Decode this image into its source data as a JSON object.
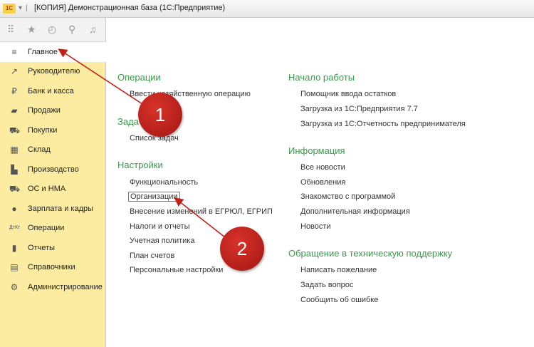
{
  "window": {
    "logo_text": "1С",
    "title": "[КОПИЯ] Демонстрационная база  (1С:Предприятие)"
  },
  "toolbar_icons": [
    "apps-grid-icon",
    "star-icon",
    "history-icon",
    "search-icon",
    "bell-icon"
  ],
  "sidebar": {
    "items": [
      {
        "label": "Главное",
        "icon": "menu-lines-icon",
        "glyph": "≡"
      },
      {
        "label": "Руководителю",
        "icon": "trend-icon",
        "glyph": "↗"
      },
      {
        "label": "Банк и касса",
        "icon": "coin-icon",
        "glyph": "₽"
      },
      {
        "label": "Продажи",
        "icon": "bag-icon",
        "glyph": "▰"
      },
      {
        "label": "Покупки",
        "icon": "cart-icon",
        "glyph": "⛟"
      },
      {
        "label": "Склад",
        "icon": "warehouse-icon",
        "glyph": "▦"
      },
      {
        "label": "Производство",
        "icon": "factory-icon",
        "glyph": "▙"
      },
      {
        "label": "ОС и НМА",
        "icon": "truck-icon",
        "glyph": "⛟"
      },
      {
        "label": "Зарплата и кадры",
        "icon": "person-icon",
        "glyph": "●"
      },
      {
        "label": "Операции",
        "icon": "operations-icon",
        "glyph": "ДтКт"
      },
      {
        "label": "Отчеты",
        "icon": "bar-chart-icon",
        "glyph": "▮"
      },
      {
        "label": "Справочники",
        "icon": "books-icon",
        "glyph": "▤"
      },
      {
        "label": "Администрирование",
        "icon": "gear-icon",
        "glyph": "⚙"
      }
    ]
  },
  "left_col": {
    "operations": {
      "heading": "Операции",
      "links": [
        "Ввести хозяйственную операцию"
      ]
    },
    "tasks": {
      "heading": "Задачи",
      "links": [
        "Список задач"
      ]
    },
    "settings": {
      "heading": "Настройки",
      "links": [
        "Функциональность",
        "Организации",
        "Внесение изменений в ЕГРЮЛ, ЕГРИП",
        "Налоги и отчеты",
        "Учетная политика",
        "План счетов",
        "Персональные настройки"
      ]
    }
  },
  "right_col": {
    "start": {
      "heading": "Начало работы",
      "links": [
        "Помощник ввода остатков",
        "Загрузка из 1С:Предприятия 7.7",
        "Загрузка из 1С:Отчетность предпринимателя"
      ]
    },
    "info": {
      "heading": "Информация",
      "links": [
        "Все новости",
        "Обновления",
        "Знакомство с программой",
        "Дополнительная информация",
        "Новости"
      ]
    },
    "support": {
      "heading": "Обращение в техническую поддержку",
      "links": [
        "Написать пожелание",
        "Задать вопрос",
        "Сообщить об ошибке"
      ]
    }
  },
  "annotations": [
    "1",
    "2"
  ],
  "colors": {
    "sidebar_bg": "#fbeca2",
    "heading_green": "#3a9a4a",
    "marker_red": "#c0221a"
  }
}
